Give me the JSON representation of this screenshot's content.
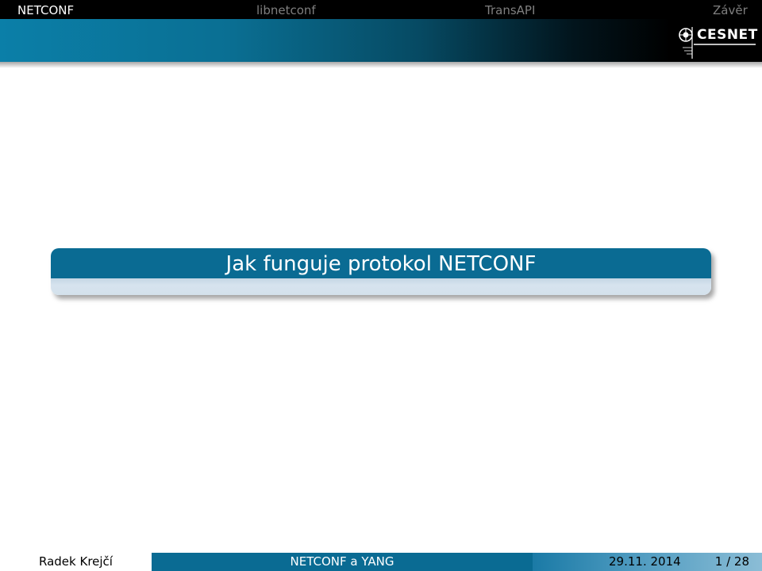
{
  "nav": {
    "items": [
      {
        "label": "NETCONF",
        "active": true
      },
      {
        "label": "libnetconf",
        "active": false
      },
      {
        "label": "TransAPI",
        "active": false
      },
      {
        "label": "Závěr",
        "active": false
      }
    ]
  },
  "logo": {
    "text": "CESNET",
    "icon": "cesnet-logo-icon"
  },
  "slide": {
    "title": "Jak funguje protokol NETCONF"
  },
  "footer": {
    "author": "Radek Krejčí",
    "title": "NETCONF a YANG",
    "date": "29.11. 2014",
    "page": "1 / 28"
  },
  "colors": {
    "accent": "#0a6b93",
    "nav_active": "#ffffff",
    "nav_inactive": "#7f7f7f",
    "box_light": "#d4e1ec"
  }
}
